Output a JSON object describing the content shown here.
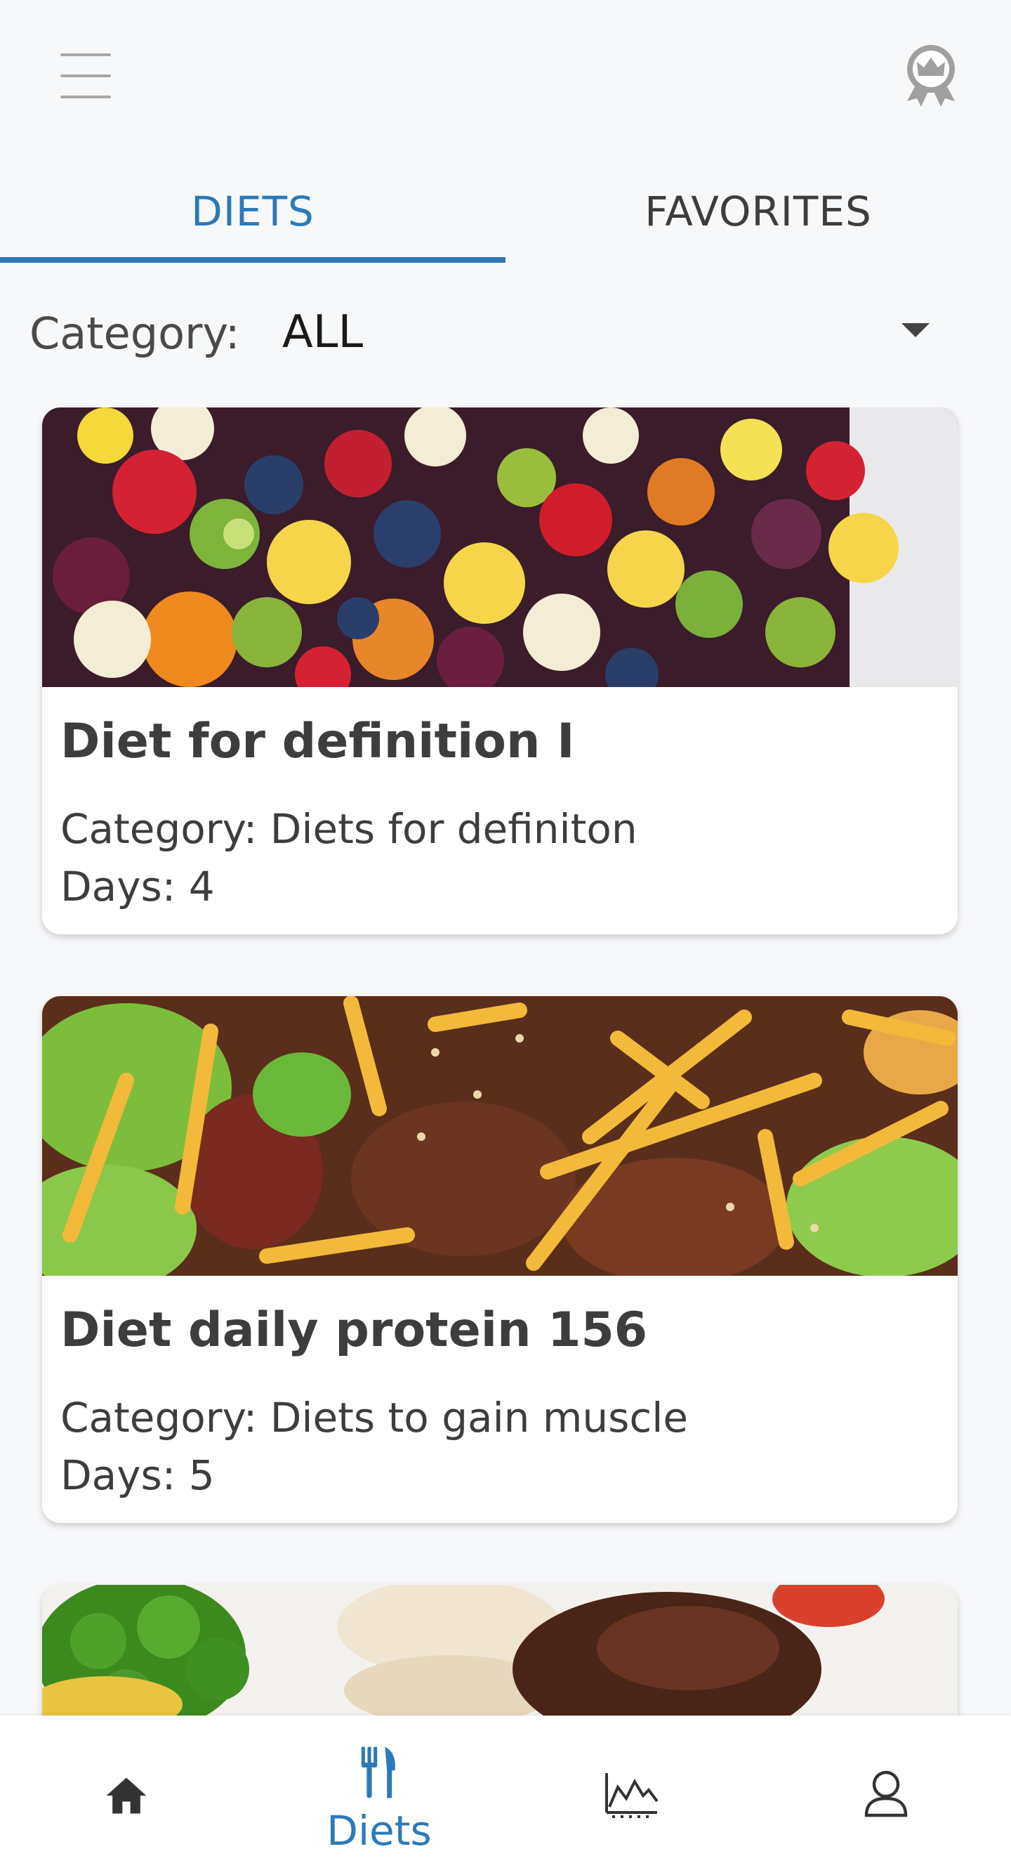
{
  "header": {
    "menu_icon": "hamburger-menu-icon",
    "award_icon": "award-ribbon-icon"
  },
  "tabs": [
    {
      "label": "DIETS",
      "active": true
    },
    {
      "label": "FAVORITES",
      "active": false
    }
  ],
  "filter": {
    "label": "Category:",
    "value": "ALL"
  },
  "cards": [
    {
      "title": "Diet for definition I",
      "category": "Category: Diets for definiton",
      "days": "Days: 4"
    },
    {
      "title": "Diet daily protein 156",
      "category": "Category: Diets to gain muscle",
      "days": "Days: 5"
    },
    {
      "title": "",
      "category": "",
      "days": ""
    }
  ],
  "bottom_nav": [
    {
      "icon": "home-icon",
      "label": ""
    },
    {
      "icon": "fork-knife-icon",
      "label": "Diets",
      "active": true
    },
    {
      "icon": "chart-icon",
      "label": ""
    },
    {
      "icon": "profile-icon",
      "label": ""
    }
  ],
  "colors": {
    "accent": "#2c79b8",
    "text": "#3d3d3d",
    "background": "#f7f8fa"
  }
}
